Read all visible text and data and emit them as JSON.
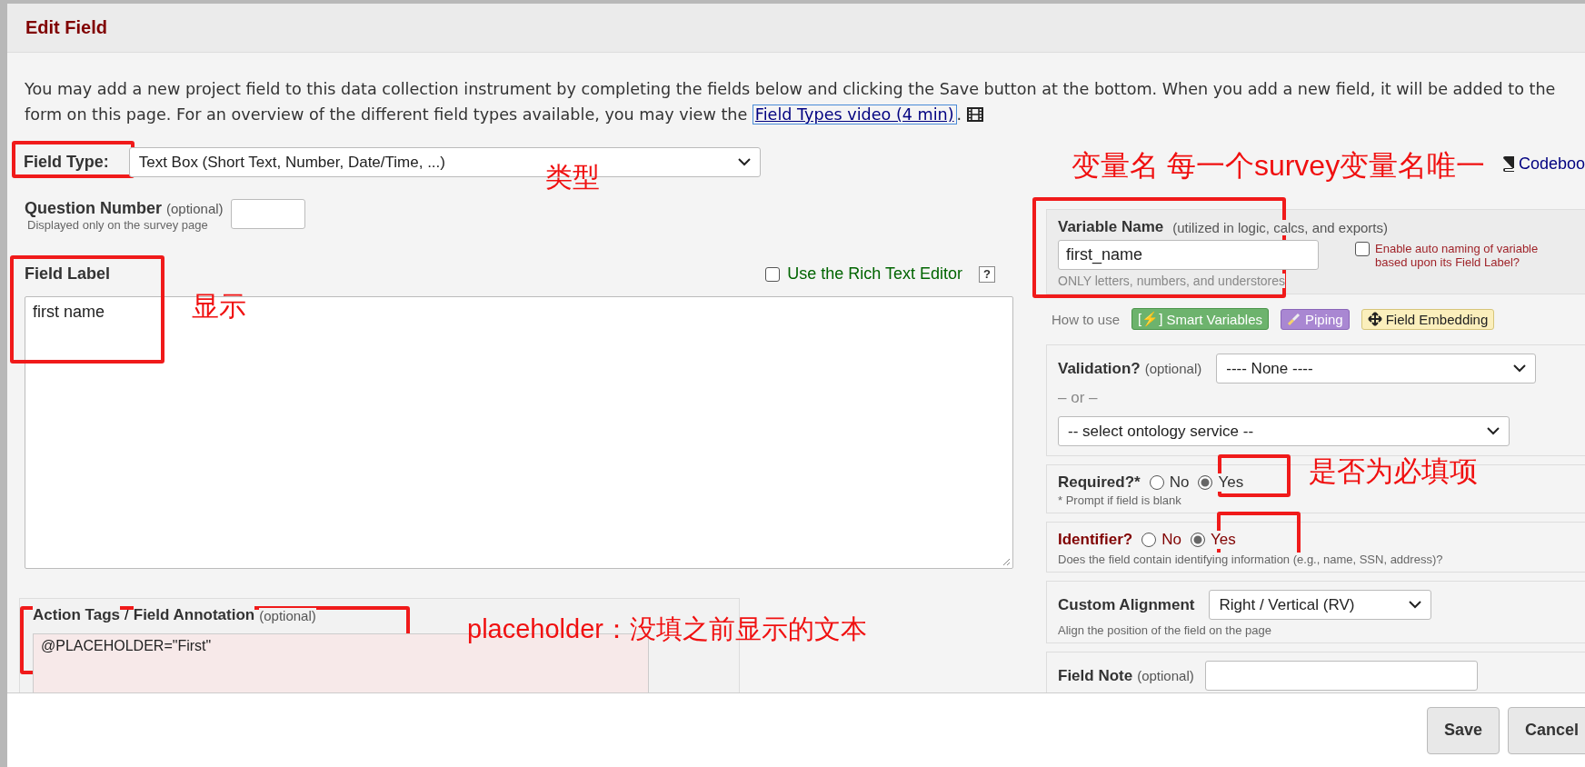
{
  "dialog": {
    "title": "Edit Field"
  },
  "intro": {
    "lines": [
      "You may add a new project field to this data collection instrument by completing the fields below and clicking the Save button at the bottom. When you add a new field, it will be added to the",
      "form on this page. For an overview of the different field types available, you may view the"
    ],
    "link": "Field Types video (4 min)",
    "after": "."
  },
  "field_type": {
    "label": "Field Type:",
    "value": "Text Box (Short Text, Number, Date/Time, ...)"
  },
  "question_number": {
    "label": "Question Number",
    "optional": "(optional)",
    "note": "Displayed only on the survey page"
  },
  "field_label": {
    "label": "Field Label",
    "rich_text": {
      "label": "Use the Rich Text Editor",
      "checked": false
    },
    "help": "?",
    "value": "first name"
  },
  "action_tags": {
    "label_1": "Action Tags",
    "sep": "/",
    "label_2": "Field Annotation",
    "optional": "(optional)",
    "value": "@PLACEHOLDER=\"First\""
  },
  "codebook": {
    "label": "Codeboo"
  },
  "variable_name": {
    "label": "Variable Name",
    "hint": "(utilized in logic, calcs, and exports)",
    "value": "first_name",
    "auto_naming": {
      "label": "Enable auto naming of variable based upon its Field Label?",
      "checked": false
    },
    "note": "ONLY letters, numbers, and understores"
  },
  "how_to_use": {
    "label": "How to use",
    "badges": [
      {
        "kind": "smart",
        "icon": "[⚡]",
        "label": "Smart Variables"
      },
      {
        "kind": "piping",
        "label": "Piping"
      },
      {
        "kind": "embed",
        "label": "Field Embedding"
      }
    ]
  },
  "validation": {
    "label": "Validation?",
    "optional": "(optional)",
    "value": "---- None ----",
    "or": "– or –",
    "ontology": "-- select ontology service --"
  },
  "required": {
    "label": "Required?*",
    "options": [
      {
        "label": "No",
        "selected": false
      },
      {
        "label": "Yes",
        "selected": true
      }
    ],
    "note": "* Prompt if field is blank"
  },
  "identifier": {
    "label": "Identifier?",
    "options": [
      {
        "label": "No",
        "selected": false
      },
      {
        "label": "Yes",
        "selected": true
      }
    ],
    "note": "Does the field contain identifying information (e.g., name, SSN, address)?"
  },
  "alignment": {
    "label": "Custom Alignment",
    "value": "Right / Vertical (RV)",
    "note": "Align the position of the field on the page"
  },
  "field_note": {
    "label": "Field Note",
    "optional": "(optional)"
  },
  "buttons": [
    {
      "label": "Save"
    },
    {
      "label": "Cancel"
    }
  ],
  "annotations": [
    "类型",
    "显示",
    "变量名 每一个survey变量名唯一",
    "是否为必填项",
    "placeholder：没填之前显示的文本"
  ]
}
